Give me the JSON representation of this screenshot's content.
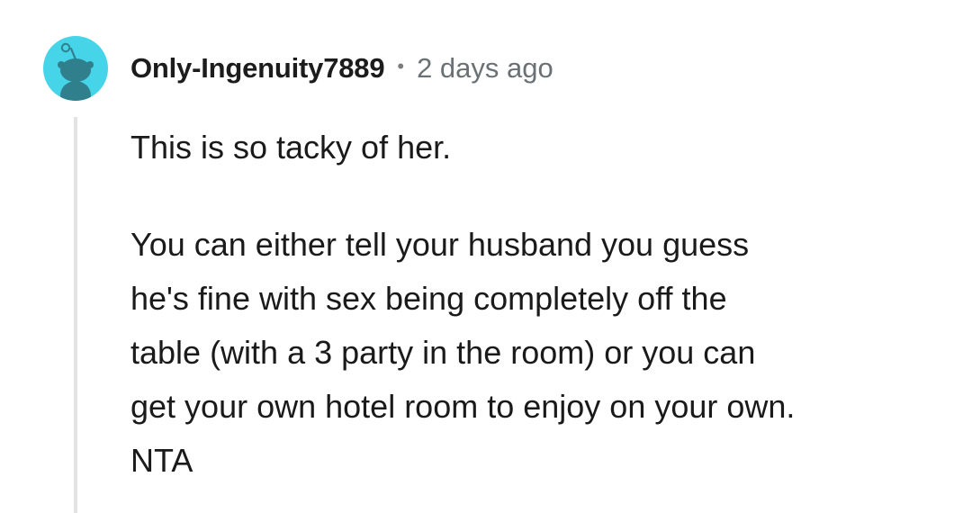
{
  "comment": {
    "author": "Only-Ingenuity7889",
    "separator": "•",
    "timestamp": "2 days ago",
    "avatar_icon": "reddit-snoo-avatar-icon",
    "avatar_color": "#46d4e8",
    "paragraph1": "This is so tacky of her.",
    "paragraph2_lines": [
      "You can either tell your husband you guess",
      "he's fine with sex being completely off the",
      "table (with a 3 party in the room) or you can",
      "get your own hotel room to enjoy on your own.",
      "NTA"
    ]
  }
}
